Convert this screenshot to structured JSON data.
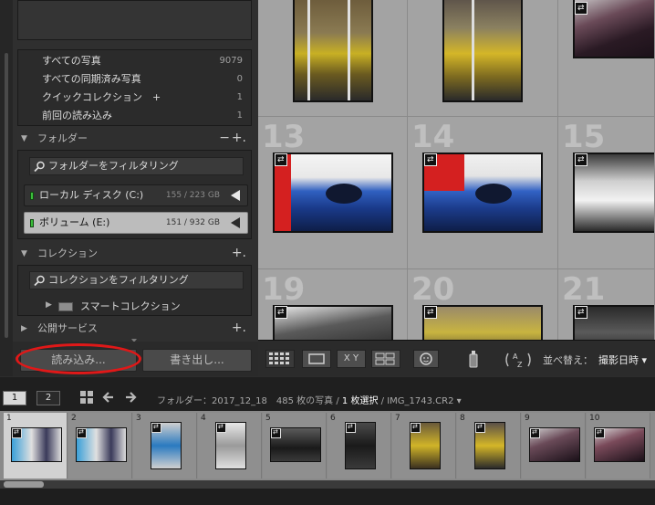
{
  "catalog": {
    "items": [
      {
        "label": "すべての写真",
        "count": "9079"
      },
      {
        "label": "すべての同期済み写真",
        "count": "0"
      },
      {
        "label": "クイックコレクション　+",
        "count": "1"
      },
      {
        "label": "前回の読み込み",
        "count": "1"
      }
    ]
  },
  "folders": {
    "title": "フォルダー",
    "minus": "−",
    "plus": "+.",
    "filter_placeholder": "フォルダーをフィルタリング",
    "volumes": [
      {
        "name": "ローカル ディスク (C:)",
        "size": "155 / 223 GB"
      },
      {
        "name": "ボリューム (E:)",
        "size": "151 / 932 GB"
      }
    ]
  },
  "collections": {
    "title": "コレクション",
    "plus": "+.",
    "filter_placeholder": "コレクションをフィルタリング",
    "smart_collection": "スマートコレクション"
  },
  "publish": {
    "title": "公開サービス",
    "plus": "+."
  },
  "buttons": {
    "import": "読み込み...",
    "export": "書き出し..."
  },
  "grid": {
    "numbers": [
      "13",
      "14",
      "15",
      "19",
      "20",
      "21"
    ]
  },
  "toolbar": {
    "xy_label": "X Y",
    "sort_label": "並べ替え：",
    "sort_value": "撮影日時 ▾"
  },
  "filmstrip_bar": {
    "page1": "1",
    "page2": "2",
    "path_prefix": "フォルダー：2017_12_18　485 枚の写真 /",
    "path_selected": "1 枚選択",
    "path_suffix": "/ IMG_1743.CR2 ▾"
  },
  "filmstrip": {
    "frames": [
      "1",
      "2",
      "3",
      "4",
      "5",
      "6",
      "7",
      "8",
      "9",
      "10"
    ]
  },
  "colors": {
    "accent_red": "#e01818",
    "panel_bg": "#2f2f2f",
    "grid_bg": "#a9a9a9",
    "led_green": "#3bbf3b"
  }
}
